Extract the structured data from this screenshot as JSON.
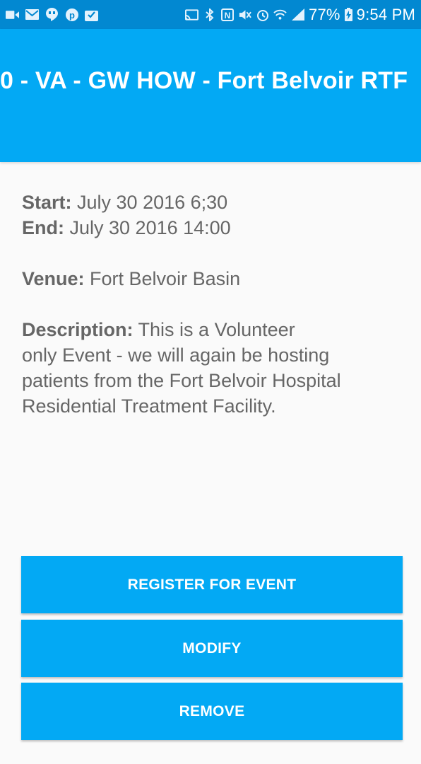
{
  "status_bar": {
    "battery": "77%",
    "time": "9:54 PM",
    "left_icons": [
      "video-icon",
      "gmail-icon",
      "hangouts-icon",
      "pinterest-icon",
      "inbox-icon"
    ],
    "right_icons": [
      "cast-icon",
      "bluetooth-icon",
      "nfc-icon",
      "mute-icon",
      "alarm-icon",
      "wifi-icon",
      "signal-icon",
      "battery-icon"
    ]
  },
  "app_bar": {
    "title": "0 - VA - GW HOW - Fort Belvoir RTF"
  },
  "event": {
    "start_label": "Start:",
    "start_value": " July 30 2016 6;30",
    "end_label": "End:",
    "end_value": " July 30 2016 14:00",
    "venue_label": "Venue:",
    "venue_value": " Fort Belvoir Basin",
    "description_label": "Description:",
    "description_line1": " This is a Volunteer",
    "description_line2": "only Event - we will again be hosting",
    "description_line3": "patients from the Fort Belvoir Hospital",
    "description_line4": "Residential Treatment Facility."
  },
  "buttons": {
    "register": "REGISTER FOR EVENT",
    "modify": "MODIFY",
    "remove": "REMOVE"
  },
  "colors": {
    "status_bar": "#0288d1",
    "app_bar": "#03a9f4",
    "button": "#03a9f4",
    "text": "#666666"
  }
}
